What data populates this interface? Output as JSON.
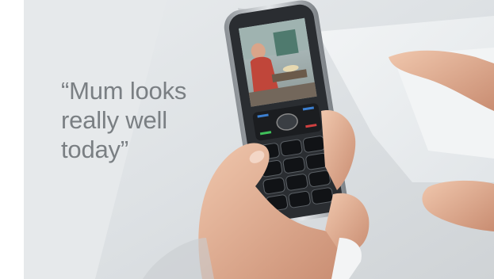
{
  "scene": {
    "description_icon": "hand-holding-phone-photo",
    "quote_lines": [
      "“Mum looks",
      "really well",
      "today”"
    ],
    "colors": {
      "quote_text": "#7a7f83",
      "table": "#dfe3e6",
      "phone_body": "#2a2d31",
      "phone_chrome": "#b9bec3",
      "skin": "#e8b79b"
    }
  }
}
